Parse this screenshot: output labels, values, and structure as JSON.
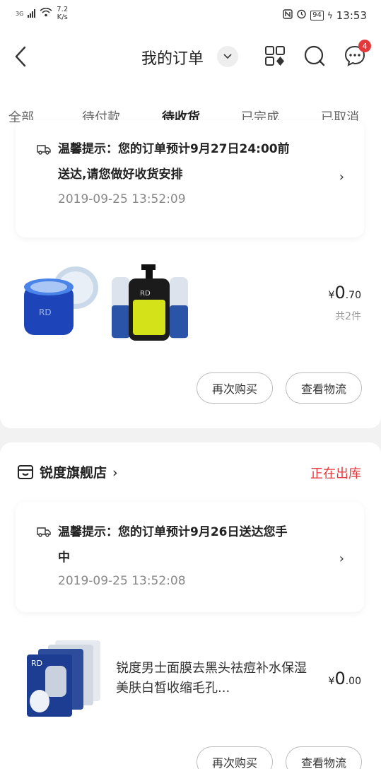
{
  "status_bar": {
    "network": "3G",
    "speed_value": "7.2",
    "speed_unit": "K/s",
    "battery": "94",
    "time": "13:53"
  },
  "header": {
    "title": "我的订单",
    "message_badge": "4"
  },
  "tabs": [
    {
      "label": "全部"
    },
    {
      "label": "待付款"
    },
    {
      "label": "待收货"
    },
    {
      "label": "已完成"
    },
    {
      "label": "已取消"
    }
  ],
  "orders": [
    {
      "tip_line1": "温馨提示：您的订单预计9月27日24:00前",
      "tip_line2": "送达,请您做好收货安排",
      "tip_time": "2019-09-25 13:52:09",
      "price_symbol": "¥",
      "price_int": "0",
      "price_dec": ".70",
      "quantity": "共2件",
      "buy_again": "再次购买",
      "view_logistics": "查看物流"
    },
    {
      "store_name": "锐度旗舰店",
      "status": "正在出库",
      "tip_line1": "温馨提示：您的订单预计9月26日送达您手",
      "tip_line2": "中",
      "tip_time": "2019-09-25 13:52:08",
      "product_title": "锐度男士面膜去黑头祛痘补水保湿美肤白皙收缩毛孔...",
      "price_symbol": "¥",
      "price_int": "0",
      "price_dec": ".00",
      "buy_again": "再次购买",
      "view_logistics": "查看物流"
    }
  ],
  "colors": {
    "accent": "#e4393c",
    "background": "#f2f2f2"
  }
}
